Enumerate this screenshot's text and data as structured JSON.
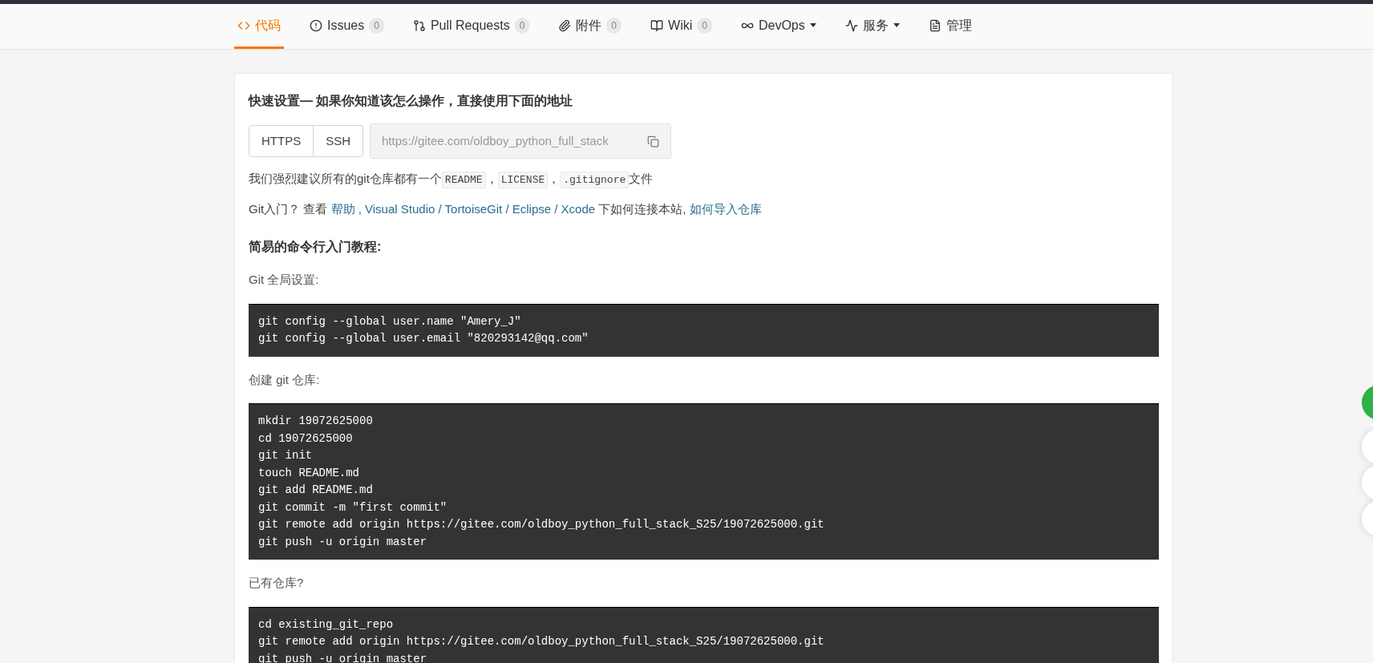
{
  "tabs": [
    {
      "label": "代码",
      "selected": true
    },
    {
      "label": "Issues",
      "count": "0",
      "selected": false
    },
    {
      "label": "Pull Requests",
      "count": "0",
      "selected": false
    },
    {
      "label": "附件",
      "count": "0",
      "selected": false
    },
    {
      "label": "Wiki",
      "count": "0",
      "selected": false
    },
    {
      "label": "DevOps",
      "dropdown": true,
      "selected": false
    },
    {
      "label": "服务",
      "dropdown": true,
      "selected": false
    },
    {
      "label": "管理",
      "selected": false
    }
  ],
  "quick_setup": {
    "title": "快速设置— 如果你知道该怎么操作，直接使用下面的地址",
    "protocols": [
      {
        "label": "HTTPS",
        "selected": false
      },
      {
        "label": "SSH",
        "selected": false
      }
    ],
    "url": "https://gitee.com/oldboy_python_full_stack",
    "recommend": [
      {
        "kind": "text",
        "text": "我们强烈建议所有的git仓库都有一个"
      },
      {
        "kind": "code",
        "text": "README"
      },
      {
        "kind": "text",
        "text": "，"
      },
      {
        "kind": "code",
        "text": "LICENSE"
      },
      {
        "kind": "text",
        "text": "，"
      },
      {
        "kind": "code",
        "text": ".gitignore"
      },
      {
        "kind": "text",
        "text": "文件"
      }
    ],
    "guide": [
      {
        "kind": "text",
        "text": "Git入门？ 查看 "
      },
      {
        "kind": "link",
        "text": "帮助"
      },
      {
        "kind": "link",
        "text": " , Visual Studio"
      },
      {
        "kind": "link",
        "text": " / TortoiseGit"
      },
      {
        "kind": "link",
        "text": " / Eclipse"
      },
      {
        "kind": "link",
        "text": " / Xcode"
      },
      {
        "kind": "text",
        "text": " 下如何连接本站, "
      },
      {
        "kind": "link",
        "text": "如何导入仓库"
      }
    ]
  },
  "tutorial": {
    "title": "简易的命令行入门教程:",
    "sections": [
      {
        "label": "Git 全局设置:",
        "lines": [
          "git config --global user.name \"Amery_J\"",
          "git config --global user.email \"820293142@qq.com\""
        ]
      },
      {
        "label": "创建 git 仓库:",
        "lines": [
          "mkdir 19072625000",
          "cd 19072625000",
          "git init",
          "touch README.md",
          "git add README.md",
          "git commit -m \"first commit\"",
          "git remote add origin https://gitee.com/oldboy_python_full_stack_S25/19072625000.git",
          "git push -u origin master"
        ]
      },
      {
        "label": "已有仓库?",
        "lines": [
          "cd existing_git_repo",
          "git remote add origin https://gitee.com/oldboy_python_full_stack_S25/19072625000.git",
          "git push -u origin master"
        ]
      }
    ]
  }
}
